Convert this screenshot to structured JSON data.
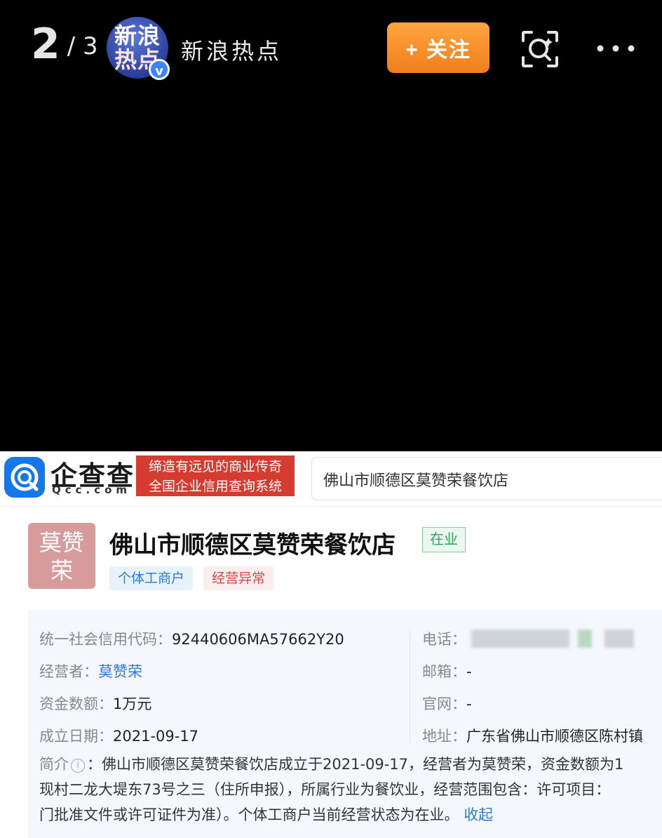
{
  "topbar": {
    "counter_current": "2",
    "counter_separator": "/",
    "counter_total": "3",
    "avatar_line1": "新浪",
    "avatar_line2": "热点",
    "verified_badge": "v",
    "account_name": "新浪热点",
    "follow_label": "+ 关注",
    "icons": [
      "scan-icon",
      "more-icon"
    ]
  },
  "qcc": {
    "brand": "企查查",
    "domain": "Qcc.com",
    "slogan_line1": "缔造有远见的商业传奇",
    "slogan_line2": "全国企业信用查询系统",
    "search_value": "佛山市顺德区莫赞荣餐饮店"
  },
  "company": {
    "avatar_line1": "莫赞",
    "avatar_line2": "荣",
    "name": "佛山市顺德区莫赞荣餐饮店",
    "status": "在业",
    "tags": [
      "个体工商户",
      "经营异常"
    ]
  },
  "info": {
    "credit_code_label": "统一社会信用代码：",
    "credit_code": "92440606MA57662Y20",
    "operator_label": "经营者：",
    "operator": "莫赞荣",
    "capital_label": "资金数额：",
    "capital": "1万元",
    "founded_label": "成立日期：",
    "founded": "2021-09-17",
    "phone_label": "电话：",
    "email_label": "邮箱：",
    "email": "-",
    "website_label": "官网：",
    "website": "-",
    "address_label": "地址：",
    "address": "广东省佛山市顺德区陈村镇",
    "intro_label": "简介",
    "intro_line1": "：佛山市顺德区莫赞荣餐饮店成立于2021-09-17，经营者为莫赞荣，资金数额为1",
    "intro_line2": "现村二龙大堤东73号之三（住所申报），所属行业为餐饮业，经营范围包含：许可项目：",
    "intro_line3": "门批准文件或许可证件为准）。个体工商户当前经营状态为在业。",
    "collapse_label": "收起"
  },
  "colors": {
    "follow_button": "#f28a24",
    "slogan_bg": "#d63b2f",
    "qcc_blue": "#1677e8",
    "status_green": "#29a35a",
    "link_blue": "#2e7bd6"
  }
}
